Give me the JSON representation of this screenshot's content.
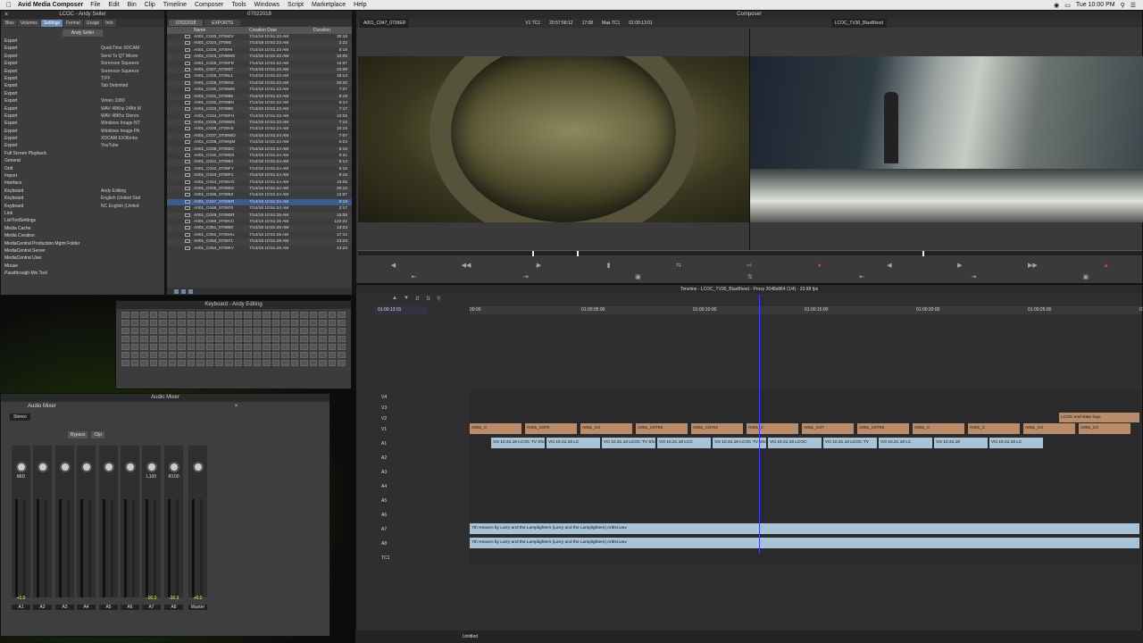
{
  "menubar": {
    "apple": "",
    "app": "Avid Media Composer",
    "items": [
      "File",
      "Edit",
      "Bin",
      "Clip",
      "Timeline",
      "Composer",
      "Tools",
      "Windows",
      "Script",
      "Marketplace",
      "Help"
    ],
    "clock": "Tue 10:00 PM"
  },
  "settings": {
    "title": "LCOC - Andy Seiler",
    "tabs": [
      "Bins",
      "Volumes",
      "Settings",
      "Format",
      "Usage",
      "Info"
    ],
    "user": "Andy Seiler",
    "rows": [
      [
        "Export",
        ""
      ],
      [
        "Export",
        "QuickTime XDCAM"
      ],
      [
        "Export",
        "Send To QT Movie"
      ],
      [
        "Export",
        "Sorenson Squeeze"
      ],
      [
        "Export",
        "Sorenson Squeeze"
      ],
      [
        "Export",
        "TIFF"
      ],
      [
        "Export",
        "Tab Delimited"
      ],
      [
        "Export",
        ""
      ],
      [
        "Export",
        "Vimeo 1080"
      ],
      [
        "Export",
        "WAV 48Khz 24Bit M"
      ],
      [
        "Export",
        "WAV 48Khz Stereo"
      ],
      [
        "Export",
        "Windows Image NT"
      ],
      [
        "Export",
        "Windows Image PA"
      ],
      [
        "Export",
        "XDCAM EX36mbs"
      ],
      [
        "Export",
        "YouTube"
      ],
      [
        "Full Screen Playback",
        ""
      ],
      [
        "General",
        ""
      ],
      [
        "Grid",
        ""
      ],
      [
        "Import",
        ""
      ],
      [
        "Interface",
        ""
      ],
      [
        "Keyboard",
        "Andy Editing"
      ],
      [
        "Keyboard",
        "English (United Stat"
      ],
      [
        "Keyboard",
        "NC English (United"
      ],
      [
        "Link",
        ""
      ],
      [
        "ListToolSettings",
        ""
      ],
      [
        "Media Cache",
        ""
      ],
      [
        "Media Creation",
        ""
      ],
      [
        "MediaCentral Production Mgmt Folder",
        ""
      ],
      [
        "MediaCentral Server",
        ""
      ],
      [
        "MediaCentral User",
        ""
      ],
      [
        "Mouse",
        ""
      ],
      [
        "Passthrough Mix Tool",
        ""
      ]
    ]
  },
  "bin": {
    "tabs": [
      "07022018",
      "EXPORTS"
    ],
    "title": "07022018",
    "cols": [
      "",
      "Name",
      "Creation Date",
      "Duration"
    ],
    "rows": [
      [
        "A001_C020_0709ZV",
        "7/14/18 10:51:23 AM",
        "30:16"
      ],
      [
        "A001_C024_0709S",
        "7/14/18 10:51:23 AM",
        "2:22"
      ],
      [
        "A001_C025_0709HI",
        "7/14/18 10:51:23 AM",
        "8:18"
      ],
      [
        "A001_C023_0709W8",
        "7/14/18 10:51:23 AM",
        "10:05"
      ],
      [
        "A001_C026_0709FD",
        "7/14/18 10:51:23 AM",
        "12:07"
      ],
      [
        "A001_C027_070937",
        "7/14/18 10:51:23 AM",
        "24:09"
      ],
      [
        "A001_C028_0709L1",
        "7/14/18 10:51:23 AM",
        "18:13"
      ],
      [
        "A001_C029_0709XZ",
        "7/14/18 10:51:23 AM",
        "20:20"
      ],
      [
        "A001_C030_0709W8",
        "7/14/18 10:51:23 AM",
        "7:07"
      ],
      [
        "A001_C031_070985",
        "7/14/18 10:51:23 AM",
        "9:19"
      ],
      [
        "A001_C032_07096N",
        "7/14/18 10:51:23 AM",
        "6:24"
      ],
      [
        "A001_C033_070980",
        "7/14/18 10:51:23 AM",
        "7:17"
      ],
      [
        "A001_C034_0709FH",
        "7/14/18 10:51:23 AM",
        "10:05"
      ],
      [
        "A001_C035_0709W3",
        "7/14/18 10:51:23 AM",
        "7:22"
      ],
      [
        "A001_C036_0709V8",
        "7/14/18 10:51:24 AM",
        "10:15"
      ],
      [
        "A001_C037_0709WD",
        "7/14/18 10:51:24 AM",
        "7:07"
      ],
      [
        "A001_C038_0709QM",
        "7/14/18 10:51:24 AM",
        "6:23"
      ],
      [
        "A001_C039_0709DC",
        "7/14/18 10:51:24 AM",
        "6:16"
      ],
      [
        "A001_C040_0709DS",
        "7/14/18 10:51:24 AM",
        "6:21"
      ],
      [
        "A001_C041_070984",
        "7/14/18 10:51:24 AM",
        "9:14"
      ],
      [
        "A001_C042_0709FY",
        "7/14/18 10:51:24 AM",
        "5:15"
      ],
      [
        "A001_C043_0709F1",
        "7/14/18 10:51:24 AM",
        "6:16"
      ],
      [
        "A001_C044_0709VO",
        "7/14/18 10:51:24 AM",
        "10:05"
      ],
      [
        "A001_C045_0709D4",
        "7/14/18 10:51:24 AM",
        "20:12"
      ],
      [
        "A001_C046_07099Z",
        "7/14/18 10:51:24 AM",
        "12:07"
      ],
      [
        "A001_C047_0709ER",
        "7/14/18 10:51:24 AM",
        "9:19"
      ],
      [
        "A001_C048_070970",
        "7/14/18 10:51:24 AM",
        "2:17"
      ],
      [
        "A001_C049_0709DR",
        "7/14/18 10:51:25 AM",
        "15:05"
      ],
      [
        "A001_C050_0709C0",
        "7/14/18 10:51:25 AM",
        "122:22"
      ],
      [
        "A001_C051_070960",
        "7/14/18 10:51:25 AM",
        "13:23"
      ],
      [
        "A001_C052_0709HU",
        "7/14/18 10:51:25 AM",
        "17:12"
      ],
      [
        "A001_C053_070971",
        "7/14/18 10:51:25 AM",
        "13:23"
      ],
      [
        "A001_C054_0709KY",
        "7/14/18 10:51:25 AM",
        "13:23"
      ]
    ],
    "selected": 25
  },
  "composer": {
    "title": "Composer",
    "src_clip": "A001_C047_0709ER",
    "rec_seq": "LCOC_TV30_BlueBlood",
    "tc1": "V1 TC1",
    "tc2": "20:57:58:12",
    "tc3": "17:08",
    "tc4": "Mas TC1",
    "tc5": "01:00:13:01"
  },
  "keyboard": {
    "title": "Keyboard - Andy Editing"
  },
  "mixer": {
    "title": "Audio Mixer",
    "label": "Audio Mixer",
    "mode": "Stereo",
    "btns": [
      "Bypass",
      "Clip"
    ],
    "strips": [
      "A1",
      "A2",
      "A3",
      "A4",
      "A5",
      "A6",
      "A7",
      "A8",
      "Master"
    ],
    "vals": [
      "+1.0",
      "",
      "",
      "",
      "",
      "",
      "-16.3",
      "-16.3",
      "+0.0"
    ],
    "pans": [
      "MID",
      "",
      "",
      "",
      "",
      "",
      "L100",
      "R100",
      ""
    ]
  },
  "timeline": {
    "title": "Timeline - LCOC_TV30_BlueBlood - Proxy 2048x864 (1/4) - 23.98 fps",
    "tc": "01:00:13:01",
    "ruler": [
      "00:00",
      "01:00:05:00",
      "01:00:10:00",
      "01:00:15:00",
      "01:00:20:00",
      "01:00:25:00",
      "01:00:3"
    ],
    "tracks": [
      "V4",
      "V3",
      "V2",
      "V1",
      "A1",
      "A2",
      "A3",
      "A4",
      "A5",
      "A6",
      "A7",
      "A8",
      "TC1"
    ],
    "video_clips": [
      "A001_C",
      "A001_C070",
      "A001_C0",
      "A001_C0709",
      "A001_C0702",
      "A001_C",
      "A001_C07",
      "A001_C0709",
      "A001_C",
      "A001_C",
      "A001_C0",
      "A001_C0"
    ],
    "vo_clips": [
      "VO 10.31.18 LCOC TV Short",
      "VO 10.31.18 LC",
      "VO 10.31.18 LCOC TV Shorts Final.wav",
      "VO 10.31.18 LCC",
      "VO 10.31.18 LCOC TV Shorts F",
      "VO 10.31.18 LCOC",
      "VO 10.31.18 LCOC TV",
      "VO 10.31.18 LC",
      "VO 10.31.18",
      "VO 10.31.18 LC"
    ],
    "slate": "LCOC end slate logo",
    "music": "7th Heaven by Larry and the Lamplighters (Larry and the Lamplighters) Artlist.wav",
    "footer": "Untitled"
  },
  "colors": {
    "accent": "#4040ff",
    "video": "#b98d6c",
    "audio": "#a8c4d6"
  }
}
